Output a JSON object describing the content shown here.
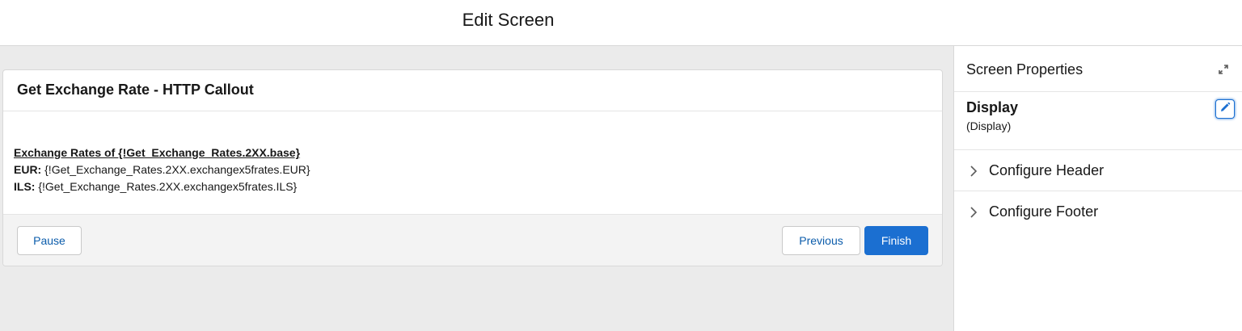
{
  "header": {
    "title": "Edit Screen"
  },
  "screen": {
    "card_title": "Get Exchange Rate - HTTP Callout",
    "body": {
      "heading": "Exchange Rates of {!Get_Exchange_Rates.2XX.base}",
      "rows": [
        {
          "label": "EUR:",
          "value": " {!Get_Exchange_Rates.2XX.exchangex5frates.EUR}"
        },
        {
          "label": "ILS:",
          "value": " {!Get_Exchange_Rates.2XX.exchangex5frates.ILS}"
        }
      ]
    },
    "footer": {
      "pause_label": "Pause",
      "previous_label": "Previous",
      "finish_label": "Finish"
    }
  },
  "properties_panel": {
    "title": "Screen Properties",
    "display_title": "Display",
    "display_subtitle": "(Display)",
    "sections": [
      {
        "label": "Configure Header"
      },
      {
        "label": "Configure Footer"
      }
    ]
  },
  "icons": {
    "expand": "expand-icon",
    "edit": "pencil-icon",
    "chevron": "chevron-right-icon"
  },
  "colors": {
    "brand": "#1b6fd1",
    "link": "#0b5cab",
    "canvas_bg": "#ebebeb",
    "footer_bg": "#f3f3f3"
  }
}
